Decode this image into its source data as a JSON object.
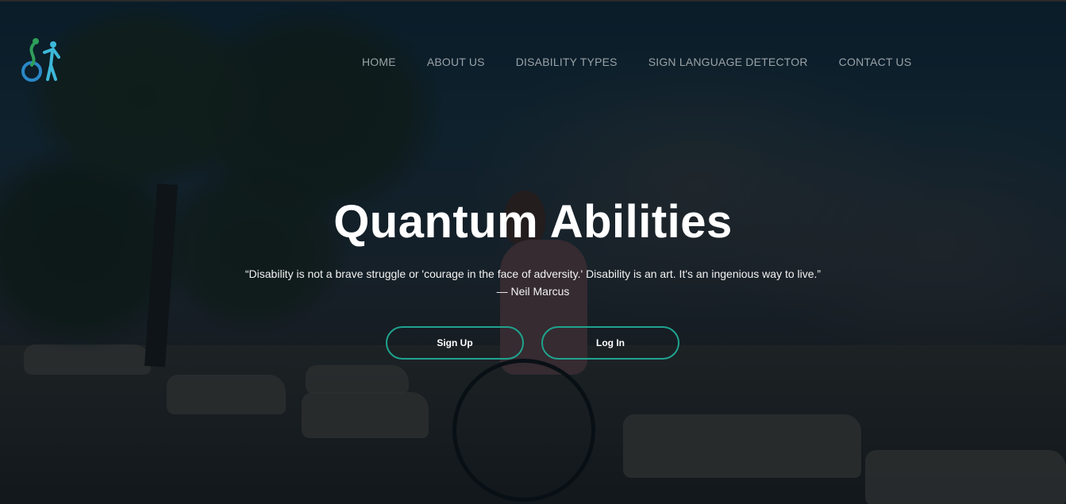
{
  "nav": {
    "items": [
      {
        "label": "HOME"
      },
      {
        "label": "ABOUT US"
      },
      {
        "label": "DISABILITY TYPES"
      },
      {
        "label": "SIGN LANGUAGE DETECTOR"
      },
      {
        "label": "CONTACT US"
      }
    ]
  },
  "logo": {
    "icon": "people-wheelchair-logo-icon",
    "colors": [
      "#2f9e5a",
      "#2a88c7",
      "#3db8d8"
    ]
  },
  "hero": {
    "title": "Quantum Abilities",
    "quote": "“Disability is not a brave struggle or 'courage in the face of adversity.' Disability is an art. It's an ingenious way to live.”",
    "author": "— Neil Marcus"
  },
  "actions": {
    "signup_label": "Sign Up",
    "login_label": "Log In",
    "border_color": "#1fa38e"
  }
}
